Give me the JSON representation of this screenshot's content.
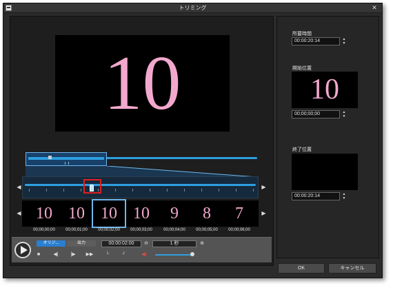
{
  "window": {
    "title": "トリミング",
    "close_label": "✕"
  },
  "preview": {
    "frame_number": "10"
  },
  "zoom_slider": {
    "position": 0.28
  },
  "filmstrip": {
    "frames": [
      "10",
      "10",
      "10",
      "10",
      "9",
      "8",
      "7"
    ],
    "selected_index": 2,
    "timecodes": [
      "00;00;00;00",
      "00;00;01;00",
      "00;00;02;00",
      "00;00;03;00",
      "00;00;04;00",
      "00;00;05;00",
      "00;00;06;00"
    ]
  },
  "controls": {
    "mode_original": "オリジ...",
    "mode_output": "出力",
    "time_value": "00:00:02:00",
    "step_value": "1 秒",
    "volume": 0.95
  },
  "right_panel": {
    "duration_label": "所要時間",
    "duration_value": "00:00:20:14",
    "start_label": "開始位置",
    "start_preview_number": "10",
    "start_value": "00;00;00;00",
    "end_label": "終了位置",
    "end_value": "00:00:20:14"
  },
  "buttons": {
    "ok": "OK",
    "cancel": "キャンセル"
  },
  "colors": {
    "accent": "#2f9fe0",
    "frame_text": "#f2a8cc",
    "highlight": "#e02020"
  }
}
